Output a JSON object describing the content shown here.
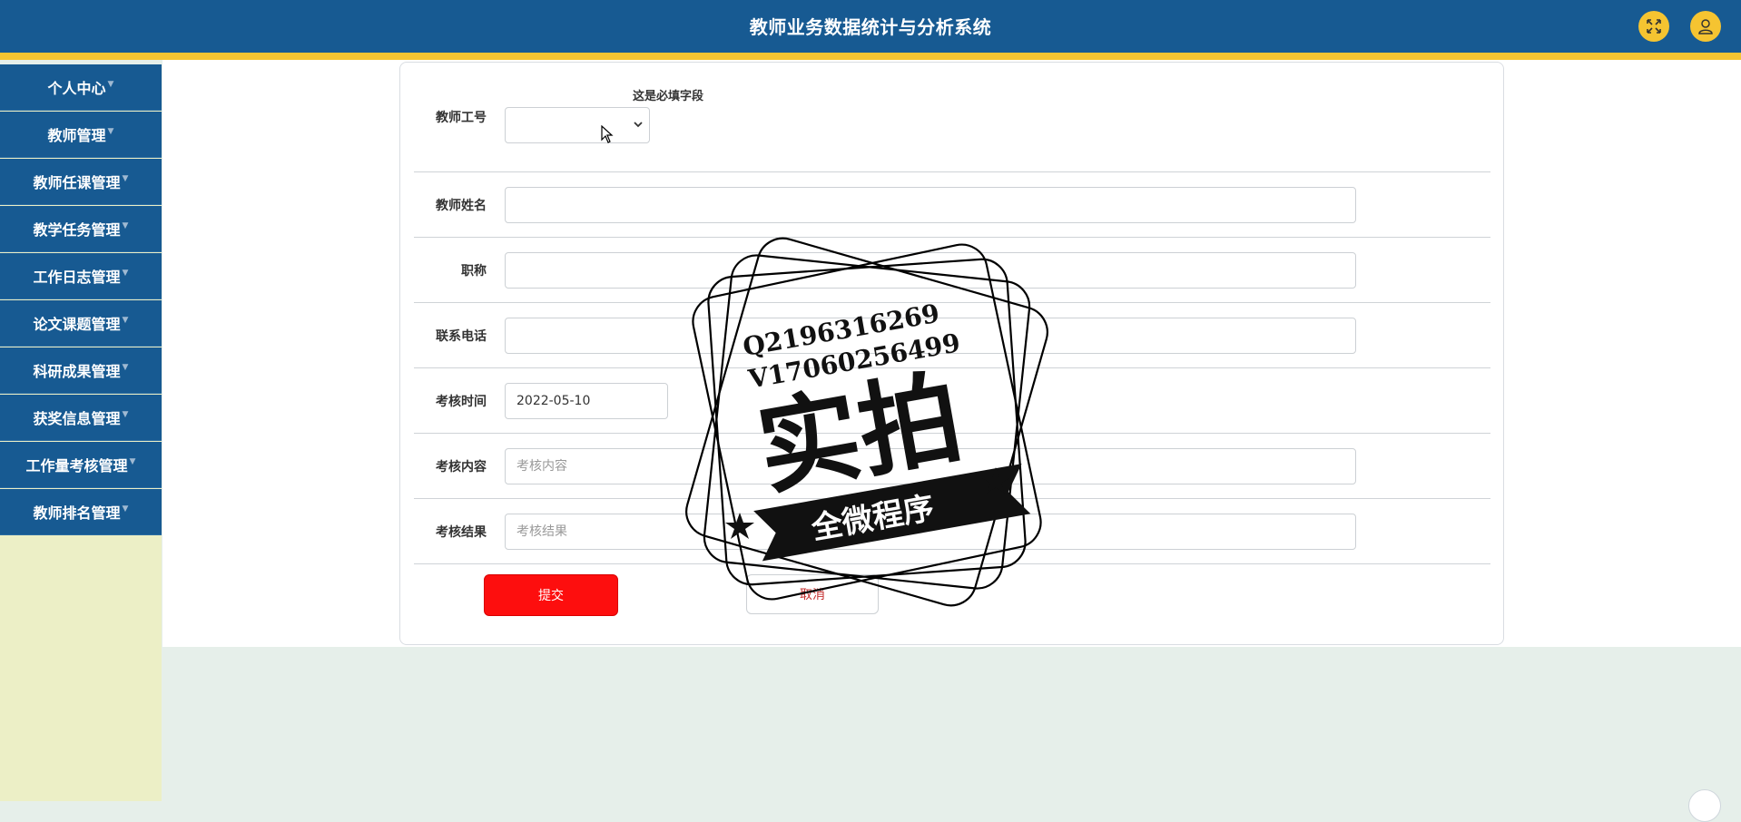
{
  "header": {
    "title": "教师业务数据统计与分析系统",
    "fullscreen_icon": "expand-icon",
    "user_icon": "user-icon"
  },
  "sidebar": {
    "items": [
      {
        "label": "个人中心"
      },
      {
        "label": "教师管理"
      },
      {
        "label": "教师任课管理"
      },
      {
        "label": "教学任务管理"
      },
      {
        "label": "工作日志管理"
      },
      {
        "label": "论文课题管理"
      },
      {
        "label": "科研成果管理"
      },
      {
        "label": "获奖信息管理"
      },
      {
        "label": "工作量考核管理"
      },
      {
        "label": "教师排名管理"
      }
    ]
  },
  "form": {
    "teacher_id": {
      "label": "教师工号",
      "value": "",
      "required_note": "这是必填字段"
    },
    "teacher_name": {
      "label": "教师姓名",
      "value": ""
    },
    "title": {
      "label": "职称",
      "value": ""
    },
    "phone": {
      "label": "联系电话",
      "value": ""
    },
    "assess_time": {
      "label": "考核时间",
      "value": "2022-05-10"
    },
    "assess_content": {
      "label": "考核内容",
      "placeholder": "考核内容"
    },
    "assess_result": {
      "label": "考核结果",
      "placeholder": "考核结果"
    },
    "submit_label": "提交",
    "cancel_label": "取消"
  },
  "watermark": {
    "line1": "Q2196316269",
    "line2": "V17060256499",
    "main": "实拍",
    "banner": "全微程序"
  },
  "colors": {
    "header_bg": "#175a92",
    "accent_yellow": "#f5c431",
    "submit_red": "#fd0e0e"
  }
}
